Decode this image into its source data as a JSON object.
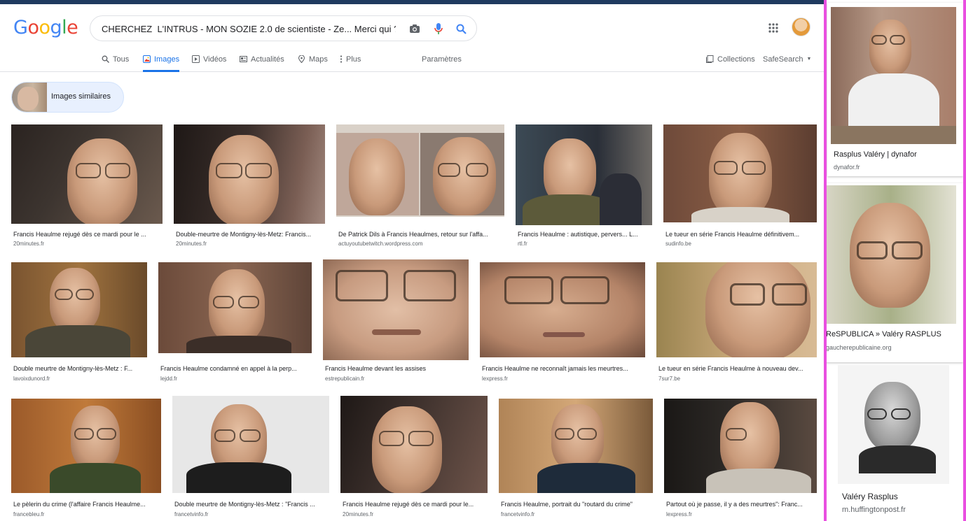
{
  "logo": {
    "text": "Google",
    "colors": [
      "#4285F4",
      "#EA4335",
      "#FBBC05",
      "#4285F4",
      "#34A853",
      "#EA4335"
    ]
  },
  "search": {
    "value": "CHERCHEZ  L'INTRUS - MON SOZIE 2.0 de scientiste - Ze... Merci qui ?"
  },
  "tabs": [
    {
      "label": "Tous",
      "icon": "search-icon"
    },
    {
      "label": "Images",
      "icon": "image-icon",
      "active": true
    },
    {
      "label": "Vidéos",
      "icon": "video-icon"
    },
    {
      "label": "Actualités",
      "icon": "news-icon"
    },
    {
      "label": "Maps",
      "icon": "map-pin-icon"
    },
    {
      "label": "Plus",
      "icon": "more-vert-icon"
    }
  ],
  "settings_label": "Paramètres",
  "collections_label": "Collections",
  "safesearch_label": "SafeSearch",
  "similar_label": "Images similaires",
  "results": [
    {
      "caption": "Francis Heaulme rejugé dès ce mardi pour le ...",
      "source": "20minutes.fr"
    },
    {
      "caption": "Double-meurtre de Montigny-lès-Metz: Francis...",
      "source": "20minutes.fr"
    },
    {
      "caption": "De Patrick Dils à Francis Heaulmes, retour sur l'affa...",
      "source": "actuyoutubetwitch.wordpress.com"
    },
    {
      "caption": "Francis Heaulme : autistique, pervers... L...",
      "source": "rtl.fr"
    },
    {
      "caption": "Le tueur en série Francis Heaulme définitivem...",
      "source": "sudinfo.be"
    },
    {
      "caption": "Double meurtre de Montigny-lès-Metz : F...",
      "source": "lavoixdunord.fr"
    },
    {
      "caption": "Francis Heaulme condamné en appel à la perp...",
      "source": "lejdd.fr"
    },
    {
      "caption": "Francis Heaulme devant les assises",
      "source": "estrepublicain.fr"
    },
    {
      "caption": "Francis Heaulme ne reconnaît jamais les meurtres...",
      "source": "lexpress.fr"
    },
    {
      "caption": "Le tueur en série Francis Heaulme à nouveau dev...",
      "source": "7sur7.be"
    },
    {
      "caption": "Le pèlerin du crime (l'affaire Francis Heaulme...",
      "source": "francebleu.fr"
    },
    {
      "caption": "Double meurtre de Montigny-lès-Metz : \"Francis ...",
      "source": "francetvinfo.fr"
    },
    {
      "caption": "Francis Heaulme rejugé dès ce mardi pour le...",
      "source": "20minutes.fr"
    },
    {
      "caption": "Francis Heaulme, portrait du \"routard du crime\"",
      "source": "francetvinfo.fr"
    },
    {
      "caption": "Partout où je passe, il y a des meurtres\": Franc...",
      "source": "lexpress.fr"
    }
  ],
  "panel": [
    {
      "title": "Rasplus Valéry | dynafor",
      "source": "dynafor.fr"
    },
    {
      "title": "ReSPUBLICA » Valéry RASPLUS",
      "source": "gaucherepublicaine.org"
    },
    {
      "title": "Valéry Rasplus",
      "source": "m.huffingtonpost.fr"
    }
  ],
  "colors": {
    "accent": "#1a73e8",
    "panel_border": "#e94fe0",
    "top_bar": "#1f3a5f"
  }
}
